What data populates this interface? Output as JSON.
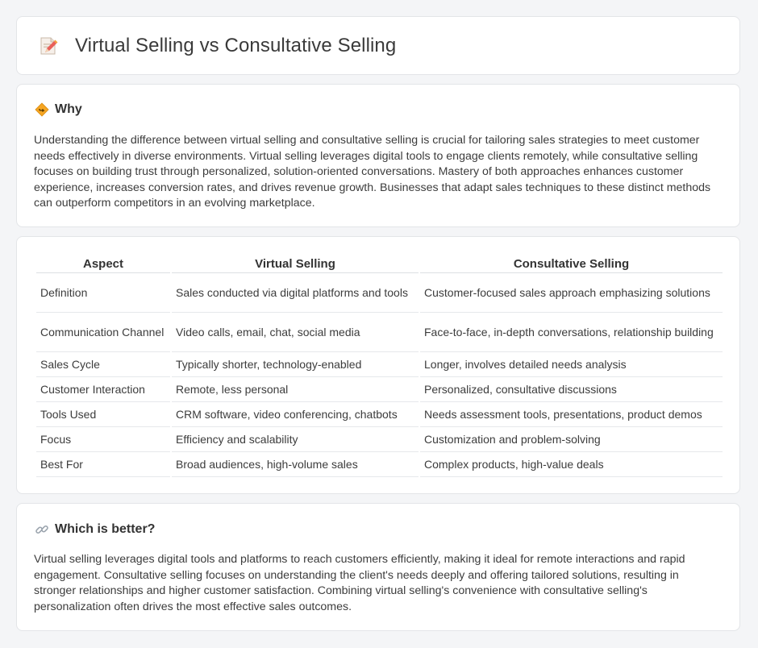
{
  "header": {
    "title": "Virtual Selling vs Consultative Selling",
    "icon": "document-pencil-icon"
  },
  "why": {
    "heading": "Why",
    "icon": "diamond-sign-icon",
    "text": "Understanding the difference between virtual selling and consultative selling is crucial for tailoring sales strategies to meet customer needs effectively in diverse environments. Virtual selling leverages digital tools to engage clients remotely, while consultative selling focuses on building trust through personalized, solution-oriented conversations. Mastery of both approaches enhances customer experience, increases conversion rates, and drives revenue growth. Businesses that adapt sales techniques to these distinct methods can outperform competitors in an evolving marketplace."
  },
  "table": {
    "headers": [
      "Aspect",
      "Virtual Selling",
      "Consultative Selling"
    ],
    "rows": [
      [
        "Definition",
        "Sales conducted via digital platforms and tools",
        "Customer-focused sales approach emphasizing solutions"
      ],
      [
        "Communication Channel",
        "Video calls, email, chat, social media",
        "Face-to-face, in-depth conversations, relationship building"
      ],
      [
        "Sales Cycle",
        "Typically shorter, technology-enabled",
        "Longer, involves detailed needs analysis"
      ],
      [
        "Customer Interaction",
        "Remote, less personal",
        "Personalized, consultative discussions"
      ],
      [
        "Tools Used",
        "CRM software, video conferencing, chatbots",
        "Needs assessment tools, presentations, product demos"
      ],
      [
        "Focus",
        "Efficiency and scalability",
        "Customization and problem-solving"
      ],
      [
        "Best For",
        "Broad audiences, high-volume sales",
        "Complex products, high-value deals"
      ]
    ]
  },
  "better": {
    "heading": "Which is better?",
    "icon": "link-icon",
    "text": "Virtual selling leverages digital tools and platforms to reach customers efficiently, making it ideal for remote interactions and rapid engagement. Consultative selling focuses on understanding the client's needs deeply and offering tailored solutions, resulting in stronger relationships and higher customer satisfaction. Combining virtual selling's convenience with consultative selling's personalization often drives the most effective sales outcomes."
  }
}
